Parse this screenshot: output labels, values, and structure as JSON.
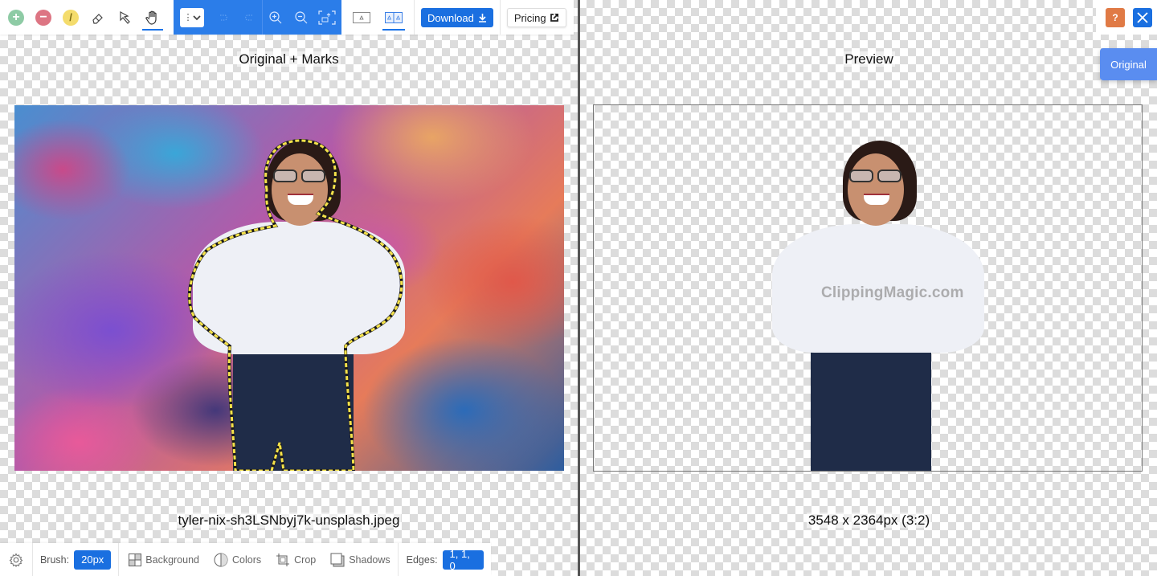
{
  "toolbar": {
    "tools": [
      {
        "name": "keep-foreground",
        "icon": "plus-circle-icon",
        "color": "#7fc49a"
      },
      {
        "name": "remove-background",
        "icon": "minus-circle-icon",
        "color": "#dd6b7a"
      },
      {
        "name": "hair-tool",
        "icon": "slash-circle-icon",
        "color": "#f2d25a"
      },
      {
        "name": "eraser",
        "icon": "eraser-icon"
      },
      {
        "name": "scalpel",
        "icon": "pointer-icon"
      },
      {
        "name": "pan",
        "icon": "hand-icon",
        "active": true
      }
    ],
    "select_label": "⋮",
    "download_label": "Download",
    "pricing_label": "Pricing"
  },
  "left_pane": {
    "title": "Original + Marks",
    "filename": "tyler-nix-sh3LSNbyj7k-unsplash.jpeg"
  },
  "right_pane": {
    "title": "Preview",
    "dimensions": "3548 x 2364px (3:2)",
    "watermark": "ClippingMagic.com"
  },
  "top_right": {
    "help_label": "?",
    "original_label": "Original"
  },
  "bottombar": {
    "brush_label": "Brush:",
    "brush_value": "20px",
    "background_label": "Background",
    "colors_label": "Colors",
    "crop_label": "Crop",
    "shadows_label": "Shadows",
    "edges_label": "Edges:",
    "edges_value": "1, 1, 0"
  },
  "colors": {
    "accent": "#1a6fe0",
    "toolbar_blue": "#2b7de9",
    "help_orange": "#e07a45",
    "marks_yellow": "#f5e24a"
  }
}
